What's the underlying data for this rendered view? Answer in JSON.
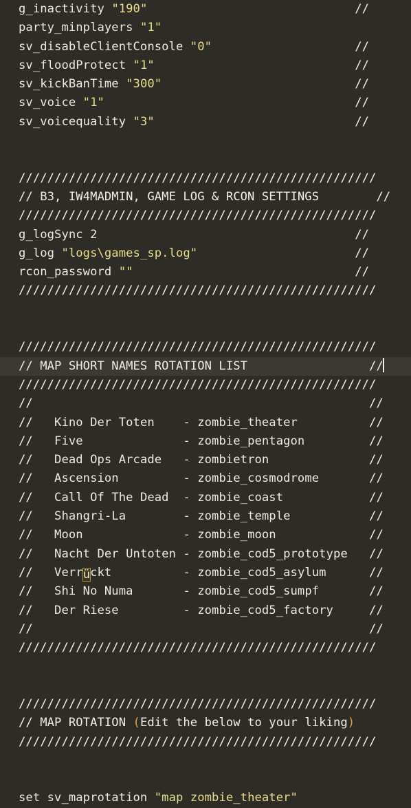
{
  "editor": {
    "app": "text-editor",
    "colors": {
      "background": "#2e2c26",
      "current_line_background": "#3b3932",
      "foreground": "#eceae3",
      "string": "#e8dd8a",
      "paren_accent": "#e0a43c",
      "nonascii_box_border": "#b8962e",
      "caret": "#f2f0e8"
    },
    "filetype": "cfg",
    "current_line_index": 19
  },
  "lines": [
    {
      "id": 1,
      "type": "setting",
      "cmd": "g_inactivity",
      "value": "\"190\"",
      "comment": "//"
    },
    {
      "id": 2,
      "type": "setting",
      "cmd": "party_minplayers",
      "value": "\"1\"",
      "comment": ""
    },
    {
      "id": 3,
      "type": "setting",
      "cmd": "sv_disableClientConsole",
      "value": "\"0\"",
      "comment": "//"
    },
    {
      "id": 4,
      "type": "setting",
      "cmd": "sv_floodProtect",
      "value": "\"1\"",
      "comment": "//"
    },
    {
      "id": 5,
      "type": "setting",
      "cmd": "sv_kickBanTime",
      "value": "\"300\"",
      "comment": "//"
    },
    {
      "id": 6,
      "type": "setting",
      "cmd": "sv_voice",
      "value": "\"1\"",
      "comment": "// "
    },
    {
      "id": 7,
      "type": "setting",
      "cmd": "sv_voicequality",
      "value": "\"3\"",
      "comment": "// "
    },
    {
      "id": 8,
      "type": "blank",
      "text": ""
    },
    {
      "id": 9,
      "type": "blank",
      "text": ""
    },
    {
      "id": 10,
      "type": "rule",
      "text": "//////////////////////////////////////////////////"
    },
    {
      "id": 11,
      "type": "banner",
      "text": "// B3, IW4MADMIN, GAME LOG & RCON SETTINGS        //"
    },
    {
      "id": 12,
      "type": "rule",
      "text": "//////////////////////////////////////////////////"
    },
    {
      "id": 13,
      "type": "setting_plain",
      "cmd": "g_logSync 2",
      "value": "",
      "comment": "//"
    },
    {
      "id": 14,
      "type": "setting",
      "cmd": "g_log",
      "value": "\"logs\\games_sp.log\"",
      "comment": "//"
    },
    {
      "id": 15,
      "type": "setting",
      "cmd": "rcon_password",
      "value": "\"\"",
      "comment": "//"
    },
    {
      "id": 16,
      "type": "rule",
      "text": "//////////////////////////////////////////////////"
    },
    {
      "id": 17,
      "type": "blank",
      "text": ""
    },
    {
      "id": 18,
      "type": "blank",
      "text": ""
    },
    {
      "id": 19,
      "type": "rule",
      "text": "//////////////////////////////////////////////////"
    },
    {
      "id": 20,
      "type": "banner_current",
      "text": "// MAP SHORT NAMES ROTATION LIST                 //"
    },
    {
      "id": 21,
      "type": "rule",
      "text": "//////////////////////////////////////////////////"
    },
    {
      "id": 22,
      "type": "comment",
      "text": "//                                               //"
    },
    {
      "id": 23,
      "type": "maprow",
      "name": "Kino Der Toten",
      "code": "zombie_theater"
    },
    {
      "id": 24,
      "type": "maprow",
      "name": "Five",
      "code": "zombie_pentagon"
    },
    {
      "id": 25,
      "type": "maprow",
      "name": "Dead Ops Arcade",
      "code": "zombietron"
    },
    {
      "id": 26,
      "type": "maprow",
      "name": "Ascension",
      "code": "zombie_cosmodrome"
    },
    {
      "id": 27,
      "type": "maprow",
      "name": "Call Of The Dead",
      "code": "zombie_coast"
    },
    {
      "id": 28,
      "type": "maprow",
      "name": "Shangri-La",
      "code": "zombie_temple"
    },
    {
      "id": 29,
      "type": "maprow",
      "name": "Moon",
      "code": "zombie_moon"
    },
    {
      "id": 30,
      "type": "maprow",
      "name": "Nacht Der Untoten",
      "code": "zombie_cod5_prototype"
    },
    {
      "id": 31,
      "type": "maprow_nonascii",
      "name": "Verrückt",
      "name_prefix": "Verr",
      "name_nonascii": "ü",
      "name_suffix": "ckt",
      "code": "zombie_cod5_asylum"
    },
    {
      "id": 32,
      "type": "maprow",
      "name": "Shi No Numa",
      "code": "zombie_cod5_sumpf"
    },
    {
      "id": 33,
      "type": "maprow",
      "name": "Der Riese",
      "code": "zombie_cod5_factory"
    },
    {
      "id": 34,
      "type": "comment",
      "text": "//                                               //"
    },
    {
      "id": 35,
      "type": "rule",
      "text": "//////////////////////////////////////////////////"
    },
    {
      "id": 36,
      "type": "blank",
      "text": ""
    },
    {
      "id": 37,
      "type": "blank",
      "text": ""
    },
    {
      "id": 38,
      "type": "rule",
      "text": "//////////////////////////////////////////////////"
    },
    {
      "id": 39,
      "type": "banner_paren",
      "pre": "// MAP ROTATION ",
      "open": "(",
      "inner": "Edit the below to your liking",
      "close": ")"
    },
    {
      "id": 40,
      "type": "rule",
      "text": "//////////////////////////////////////////////////"
    },
    {
      "id": 41,
      "type": "blank",
      "text": ""
    },
    {
      "id": 42,
      "type": "blank",
      "text": ""
    },
    {
      "id": 43,
      "type": "setcmd",
      "cmd": "set sv_maprotation ",
      "quote_open": "\"",
      "kw": "map",
      "sp": " ",
      "arg": "zombie_theater",
      "quote_close": "\""
    }
  ],
  "maplist": {
    "gutter": "//",
    "separator": "-",
    "trail": "//",
    "name_col_width": 18
  }
}
